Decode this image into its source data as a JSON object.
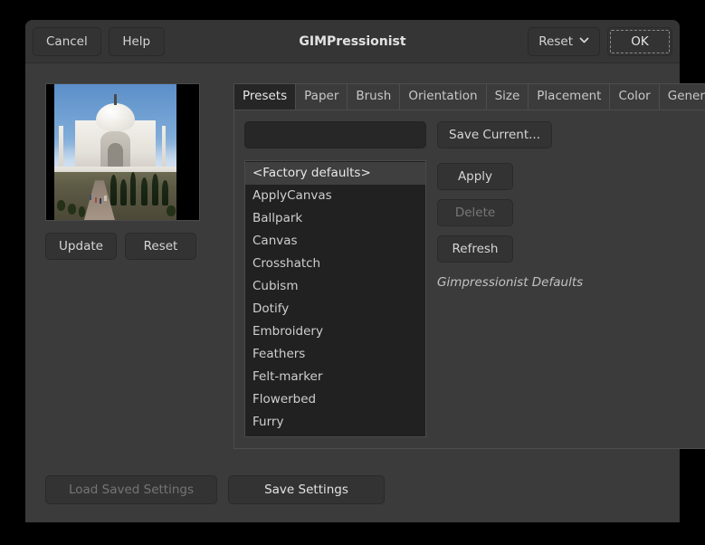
{
  "window": {
    "title": "GIMPressionist"
  },
  "header": {
    "cancel_label": "Cancel",
    "help_label": "Help",
    "reset_label": "Reset",
    "ok_label": "OK"
  },
  "preview": {
    "update_label": "Update",
    "reset_label": "Reset"
  },
  "tabs": [
    {
      "label": "Presets",
      "active": true
    },
    {
      "label": "Paper",
      "active": false
    },
    {
      "label": "Brush",
      "active": false
    },
    {
      "label": "Orientation",
      "active": false
    },
    {
      "label": "Size",
      "active": false
    },
    {
      "label": "Placement",
      "active": false
    },
    {
      "label": "Color",
      "active": false
    },
    {
      "label": "General",
      "active": false
    }
  ],
  "presets": {
    "name_value": "",
    "name_placeholder": "",
    "items": [
      {
        "label": "<Factory defaults>",
        "selected": true
      },
      {
        "label": "ApplyCanvas",
        "selected": false
      },
      {
        "label": "Ballpark",
        "selected": false
      },
      {
        "label": "Canvas",
        "selected": false
      },
      {
        "label": "Crosshatch",
        "selected": false
      },
      {
        "label": "Cubism",
        "selected": false
      },
      {
        "label": "Dotify",
        "selected": false
      },
      {
        "label": "Embroidery",
        "selected": false
      },
      {
        "label": "Feathers",
        "selected": false
      },
      {
        "label": "Felt-marker",
        "selected": false
      },
      {
        "label": "Flowerbed",
        "selected": false
      },
      {
        "label": "Furry",
        "selected": false
      }
    ],
    "save_current_label": "Save Current...",
    "apply_label": "Apply",
    "delete_label": "Delete",
    "refresh_label": "Refresh",
    "description": "Gimpressionist Defaults"
  },
  "footer": {
    "load_saved_settings_label": "Load Saved Settings",
    "save_settings_label": "Save Settings"
  },
  "colors": {
    "window_bg": "#3b3b3b",
    "header_bg": "#353535",
    "button_bg": "#333333",
    "list_bg": "#212121",
    "selected_row": "#3f3f3f",
    "text": "#d6d6d6",
    "disabled_text": "#777777"
  }
}
